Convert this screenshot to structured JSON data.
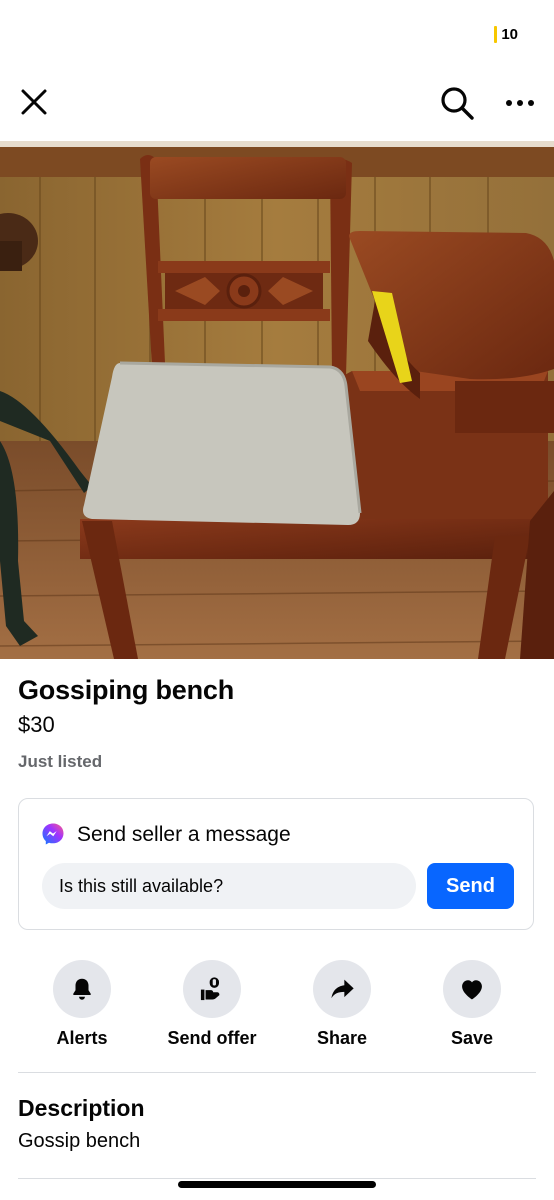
{
  "status": {
    "battery": "10",
    "battery_color": "#f7c700"
  },
  "topbar": {
    "close_icon": "close-icon",
    "search_icon": "search-icon",
    "more_icon": "more-icon"
  },
  "listing": {
    "title": "Gossiping bench",
    "price": "$30",
    "listed": "Just listed"
  },
  "message": {
    "title": "Send seller a message",
    "input_value": "Is this still available?",
    "send_label": "Send",
    "accent": "#0866ff"
  },
  "actions": [
    {
      "label": "Alerts",
      "icon": "bell-icon"
    },
    {
      "label": "Send offer",
      "icon": "offer-icon"
    },
    {
      "label": "Share",
      "icon": "share-icon"
    },
    {
      "label": "Save",
      "icon": "heart-icon"
    }
  ],
  "description": {
    "heading": "Description",
    "text": "Gossip bench"
  }
}
